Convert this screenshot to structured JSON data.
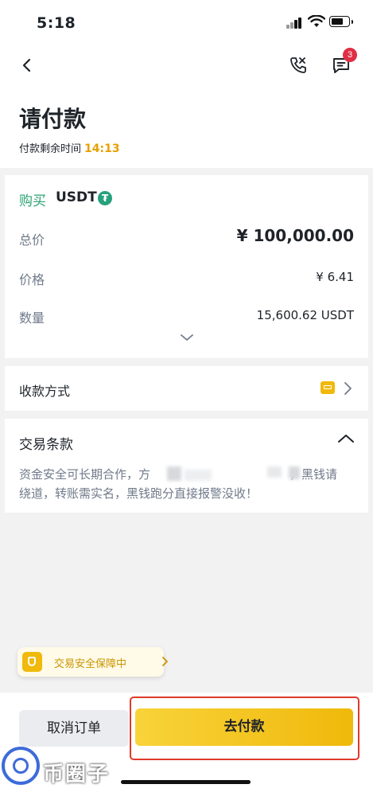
{
  "status_bar": {
    "time": "5:18"
  },
  "header": {
    "notification_count": "3",
    "title": "请付款",
    "remaining_label": "付款剩余时间",
    "countdown": "14:13"
  },
  "order": {
    "side": "购买",
    "asset": "USDT",
    "rows": [
      {
        "label": "总价",
        "value": "¥ 100,000.00"
      },
      {
        "label": "价格",
        "value": "¥ 6.41"
      },
      {
        "label": "数量",
        "value": "15,600.62 USDT"
      }
    ]
  },
  "payment_method": {
    "label": "收款方式"
  },
  "terms": {
    "title": "交易条款",
    "text_line1_start": "资金安全可长期合作，方",
    "text_line1_end": "，黑钱请",
    "text_line2": "绕道，转账需实名，黑钱跑分直接报警没收！"
  },
  "safety_badge": {
    "label": "交易安全保障中"
  },
  "actions": {
    "cancel_label": "取消订单",
    "pay_label": "去付款"
  },
  "watermark": {
    "text": "币圈子"
  },
  "colors": {
    "accent": "#f0b90b",
    "buy": "#2ea374",
    "badge": "#e02f44",
    "highlight": "#e0392a"
  }
}
